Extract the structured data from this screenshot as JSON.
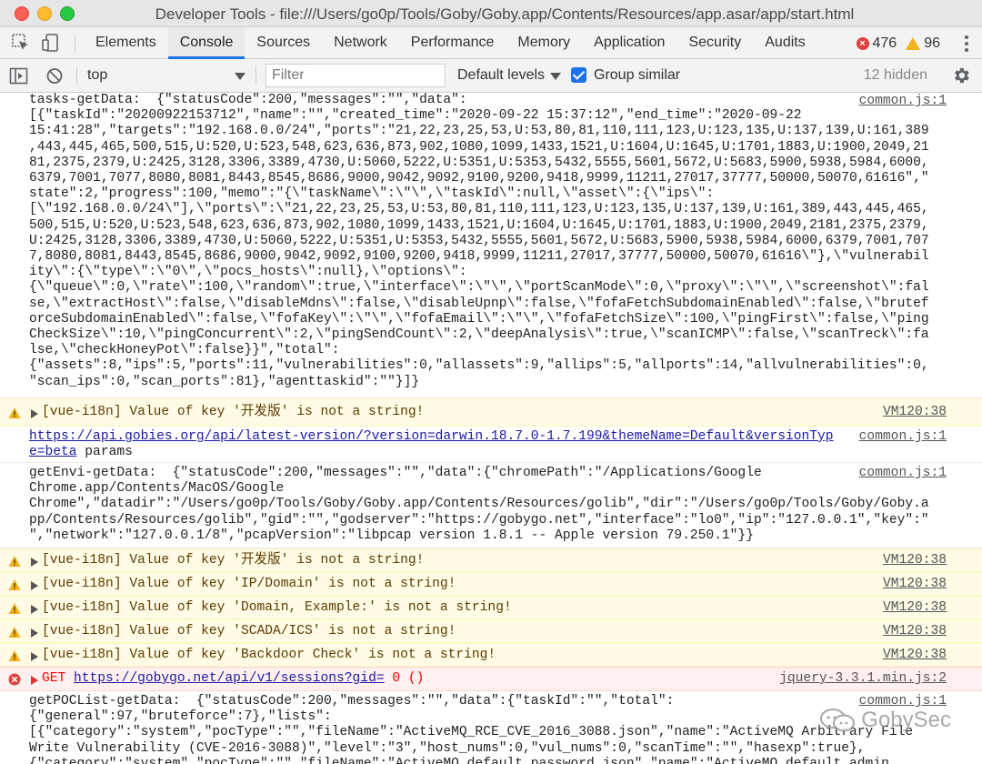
{
  "window": {
    "title": "Developer Tools - file:///Users/go0p/Tools/Goby/Goby.app/Contents/Resources/app.asar/app/start.html"
  },
  "tabs": [
    "Elements",
    "Console",
    "Sources",
    "Network",
    "Performance",
    "Memory",
    "Application",
    "Security",
    "Audits"
  ],
  "active_tab": "Console",
  "counts": {
    "errors": "476",
    "warnings": "96"
  },
  "toolbar": {
    "context": "top",
    "filter_placeholder": "Filter",
    "levels": "Default levels",
    "group_similar": "Group similar",
    "hidden": "12 hidden"
  },
  "messages": [
    {
      "type": "log",
      "source": "common.js:1",
      "lines": [
        "tasks-getData:  {\"statusCode\":200,\"messages\":\"\",\"data\":",
        "[{\"taskId\":\"20200922153712\",\"name\":\"\",\"created_time\":\"2020-09-22 15:37:12\",\"end_time\":\"2020-09-22",
        "15:41:28\",\"targets\":\"192.168.0.0/24\",\"ports\":\"21,22,23,25,53,U:53,80,81,110,111,123,U:123,135,U:137,139,U:161,389",
        ",443,445,465,500,515,U:520,U:523,548,623,636,873,902,1080,1099,1433,1521,U:1604,U:1645,U:1701,1883,U:1900,2049,21",
        "81,2375,2379,U:2425,3128,3306,3389,4730,U:5060,5222,U:5351,U:5353,5432,5555,5601,5672,U:5683,5900,5938,5984,6000,",
        "6379,7001,7077,8080,8081,8443,8545,8686,9000,9042,9092,9100,9200,9418,9999,11211,27017,37777,50000,50070,61616\",\"",
        "state\":2,\"progress\":100,\"memo\":\"{\\\"taskName\\\":\\\"\\\",\\\"taskId\\\":null,\\\"asset\\\":{\\\"ips\\\":",
        "[\\\"192.168.0.0/24\\\"],\\\"ports\\\":\\\"21,22,23,25,53,U:53,80,81,110,111,123,U:123,135,U:137,139,U:161,389,443,445,465,",
        "500,515,U:520,U:523,548,623,636,873,902,1080,1099,1433,1521,U:1604,U:1645,U:1701,1883,U:1900,2049,2181,2375,2379,",
        "U:2425,3128,3306,3389,4730,U:5060,5222,U:5351,U:5353,5432,5555,5601,5672,U:5683,5900,5938,5984,6000,6379,7001,707",
        "7,8080,8081,8443,8545,8686,9000,9042,9092,9100,9200,9418,9999,11211,27017,37777,50000,50070,61616\\\"},\\\"vulnerabil",
        "ity\\\":{\\\"type\\\":\\\"0\\\",\\\"pocs_hosts\\\":null},\\\"options\\\":",
        "{\\\"queue\\\":0,\\\"rate\\\":100,\\\"random\\\":true,\\\"interface\\\":\\\"\\\",\\\"portScanMode\\\":0,\\\"proxy\\\":\\\"\\\",\\\"screenshot\\\":fal",
        "se,\\\"extractHost\\\":false,\\\"disableMdns\\\":false,\\\"disableUpnp\\\":false,\\\"fofaFetchSubdomainEnabled\\\":false,\\\"brutef",
        "orceSubdomainEnabled\\\":false,\\\"fofaKey\\\":\\\"\\\",\\\"fofaEmail\\\":\\\"\\\",\\\"fofaFetchSize\\\":100,\\\"pingFirst\\\":false,\\\"ping",
        "CheckSize\\\":10,\\\"pingConcurrent\\\":2,\\\"pingSendCount\\\":2,\\\"deepAnalysis\\\":true,\\\"scanICMP\\\":false,\\\"scanTreck\\\":fa",
        "lse,\\\"checkHoneyPot\\\":false}}\",\"total\":",
        "{\"assets\":8,\"ips\":5,\"ports\":11,\"vulnerabilities\":0,\"allassets\":9,\"allips\":5,\"allports\":14,\"allvulnerabilities\":0,",
        "\"scan_ips\":0,\"scan_ports\":81},\"agenttaskid\":\"\"}]}"
      ]
    },
    {
      "type": "warn",
      "source": "VM120:38",
      "text": "[vue-i18n] Value of key '开发版' is not a string!"
    },
    {
      "type": "log",
      "source": "common.js:1",
      "url": "https://api.gobies.org/api/latest-version/?version=darwin.18.7.0-1.7.199&themeName=Default&versionTyp",
      "url2": "e=beta",
      "tail": " params"
    },
    {
      "type": "log",
      "source": "common.js:1",
      "lines": [
        "getEnvi-getData:  {\"statusCode\":200,\"messages\":\"\",\"data\":{\"chromePath\":\"/Applications/Google",
        "Chrome.app/Contents/MacOS/Google",
        "Chrome\",\"datadir\":\"/Users/go0p/Tools/Goby/Goby.app/Contents/Resources/golib\",\"dir\":\"/Users/go0p/Tools/Goby/Goby.a",
        "pp/Contents/Resources/golib\",\"gid\":\"\",\"godserver\":\"https://gobygo.net\",\"interface\":\"lo0\",\"ip\":\"127.0.0.1\",\"key\":\"",
        "\",\"network\":\"127.0.0.1/8\",\"pcapVersion\":\"libpcap version 1.8.1 -- Apple version 79.250.1\"}}"
      ]
    },
    {
      "type": "warn",
      "source": "VM120:38",
      "text": "[vue-i18n] Value of key '开发版' is not a string!"
    },
    {
      "type": "warn",
      "source": "VM120:38",
      "text": "[vue-i18n] Value of key 'IP/Domain' is not a string!"
    },
    {
      "type": "warn",
      "source": "VM120:38",
      "text": "[vue-i18n] Value of key 'Domain, Example:' is not a string!"
    },
    {
      "type": "warn",
      "source": "VM120:38",
      "text": "[vue-i18n] Value of key 'SCADA/ICS' is not a string!"
    },
    {
      "type": "warn",
      "source": "VM120:38",
      "text": "[vue-i18n] Value of key 'Backdoor Check' is not a string!"
    },
    {
      "type": "error",
      "source": "jquery-3.3.1.min.js:2",
      "method": "GET ",
      "url": "https://gobygo.net/api/v1/sessions?gid=",
      "tail": " 0 ()"
    },
    {
      "type": "log",
      "source": "common.js:1",
      "lines": [
        "getPOCList-getData:  {\"statusCode\":200,\"messages\":\"\",\"data\":{\"taskId\":\"\",\"total\":",
        "{\"general\":97,\"bruteforce\":7},\"lists\":",
        "[{\"category\":\"system\",\"pocType\":\"\",\"fileName\":\"ActiveMQ_RCE_CVE_2016_3088.json\",\"name\":\"ActiveMQ Arbitrary File",
        "Write Vulnerability (CVE-2016-3088)\",\"level\":\"3\",\"host_nums\":0,\"vul_nums\":0,\"scanTime\":\"\",\"hasexp\":true},",
        "{\"category\":\"system\",\"pocType\":\"\",\"fileName\":\"ActiveMQ_default_password.json\",\"name\":\"ActiveMQ default admin"
      ]
    }
  ],
  "watermark": "GobySec"
}
